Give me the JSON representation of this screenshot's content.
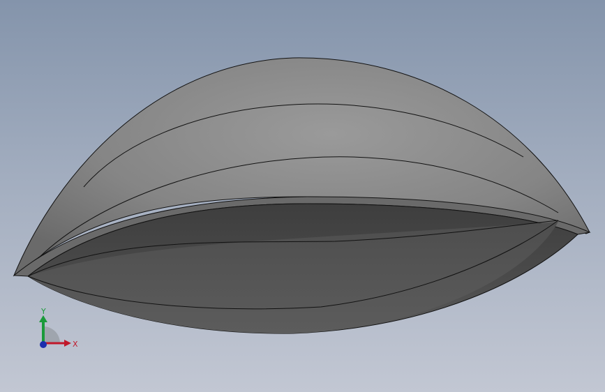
{
  "viewport": {
    "background_top": "#8494ab",
    "background_bottom": "#c2c7d3",
    "model": {
      "outer_shell_color": "#8a8a8a",
      "inner_face_color": "#4a4a4a",
      "edge_color": "#111111"
    }
  },
  "triad": {
    "x_label": "X",
    "y_label": "Y",
    "x_color": "#c0182a",
    "y_color": "#1a9a3a",
    "z_color": "#1c2fae"
  }
}
